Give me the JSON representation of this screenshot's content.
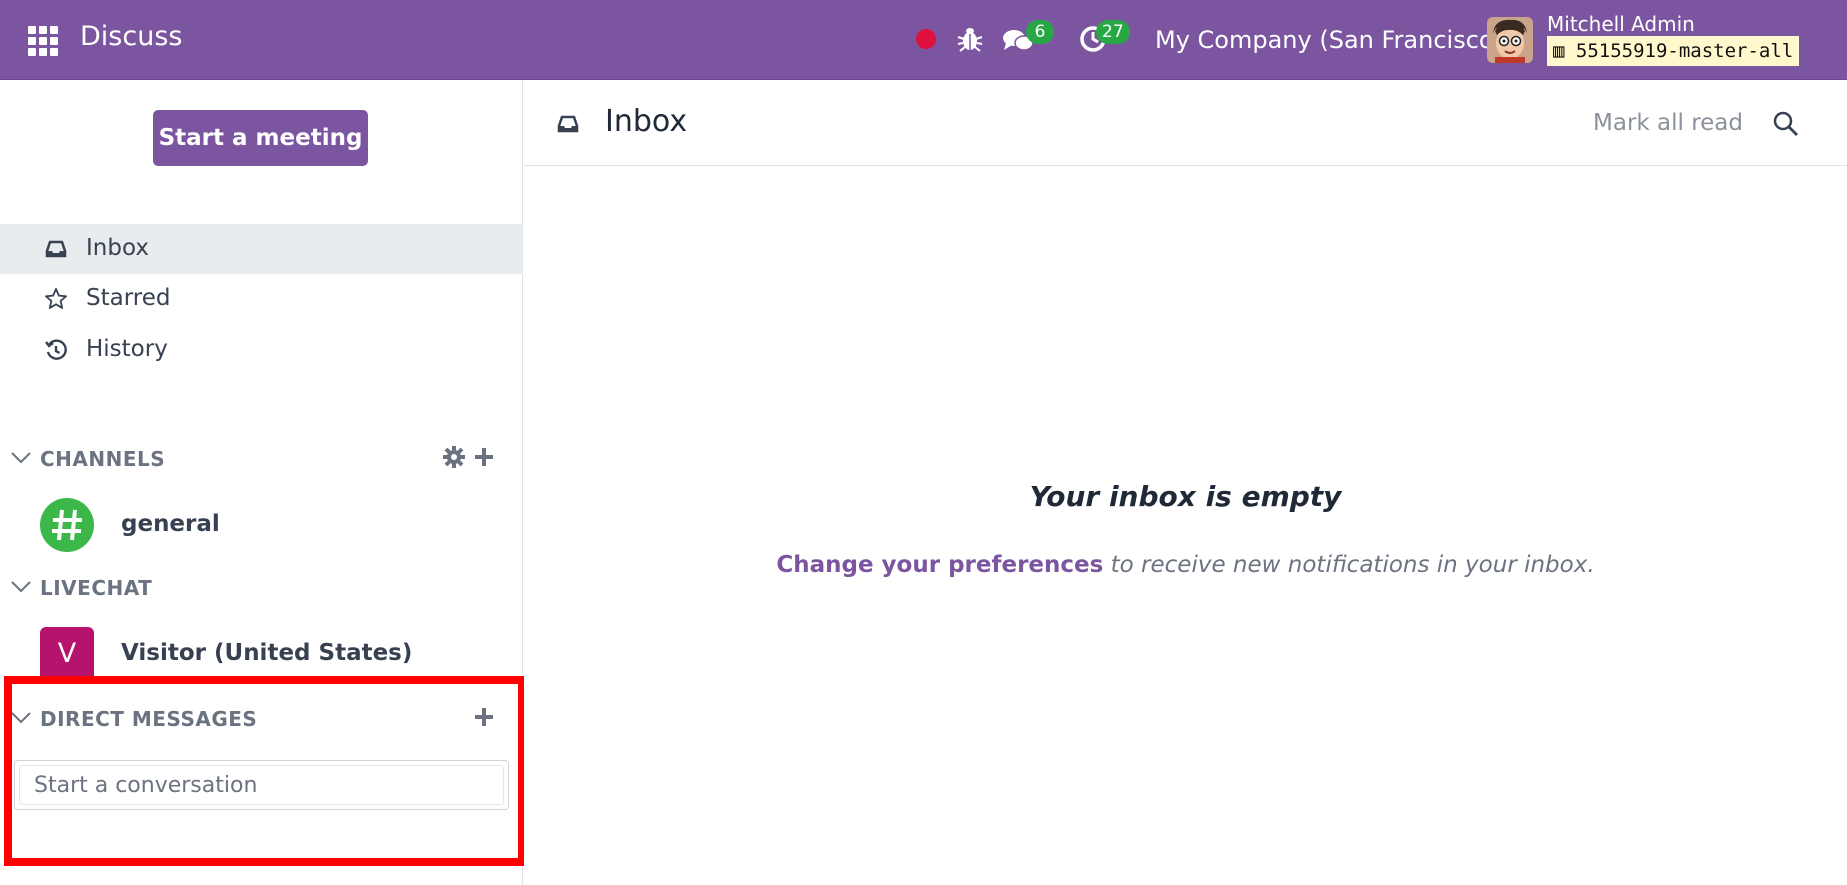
{
  "navbar": {
    "app_title": "Discuss",
    "apps_icon": "grid-icon",
    "chat_badge": "6",
    "activity_badge": "27",
    "company": "My Company (San Francisco)",
    "user_name": "Mitchell Admin",
    "database": "55155919-master-all"
  },
  "sidebar": {
    "meeting_button": "Start a meeting",
    "items": [
      {
        "label": "Inbox",
        "icon": "inbox-icon",
        "active": true
      },
      {
        "label": "Starred",
        "icon": "star-icon",
        "active": false
      },
      {
        "label": "History",
        "icon": "history-icon",
        "active": false
      }
    ],
    "channels": {
      "label": "CHANNELS",
      "items": [
        {
          "name": "general",
          "avatar_glyph": "#"
        }
      ]
    },
    "livechat": {
      "label": "LIVECHAT",
      "items": [
        {
          "name": "Visitor (United States)",
          "avatar_letter": "V"
        }
      ]
    },
    "direct_messages": {
      "label": "DIRECT MESSAGES",
      "input_placeholder": "Start a conversation"
    }
  },
  "main": {
    "title": "Inbox",
    "mark_all_read": "Mark all read",
    "empty_title": "Your inbox is empty",
    "preferences_link": "Change your preferences",
    "empty_text": "to receive new notifications in your inbox."
  },
  "colors": {
    "brand": "#7c55a0",
    "badge": "#28a745",
    "record": "#e0113c",
    "channel_avatar": "#3cb84a",
    "visitor_avatar": "#b5136e",
    "highlight": "#ff0000"
  }
}
